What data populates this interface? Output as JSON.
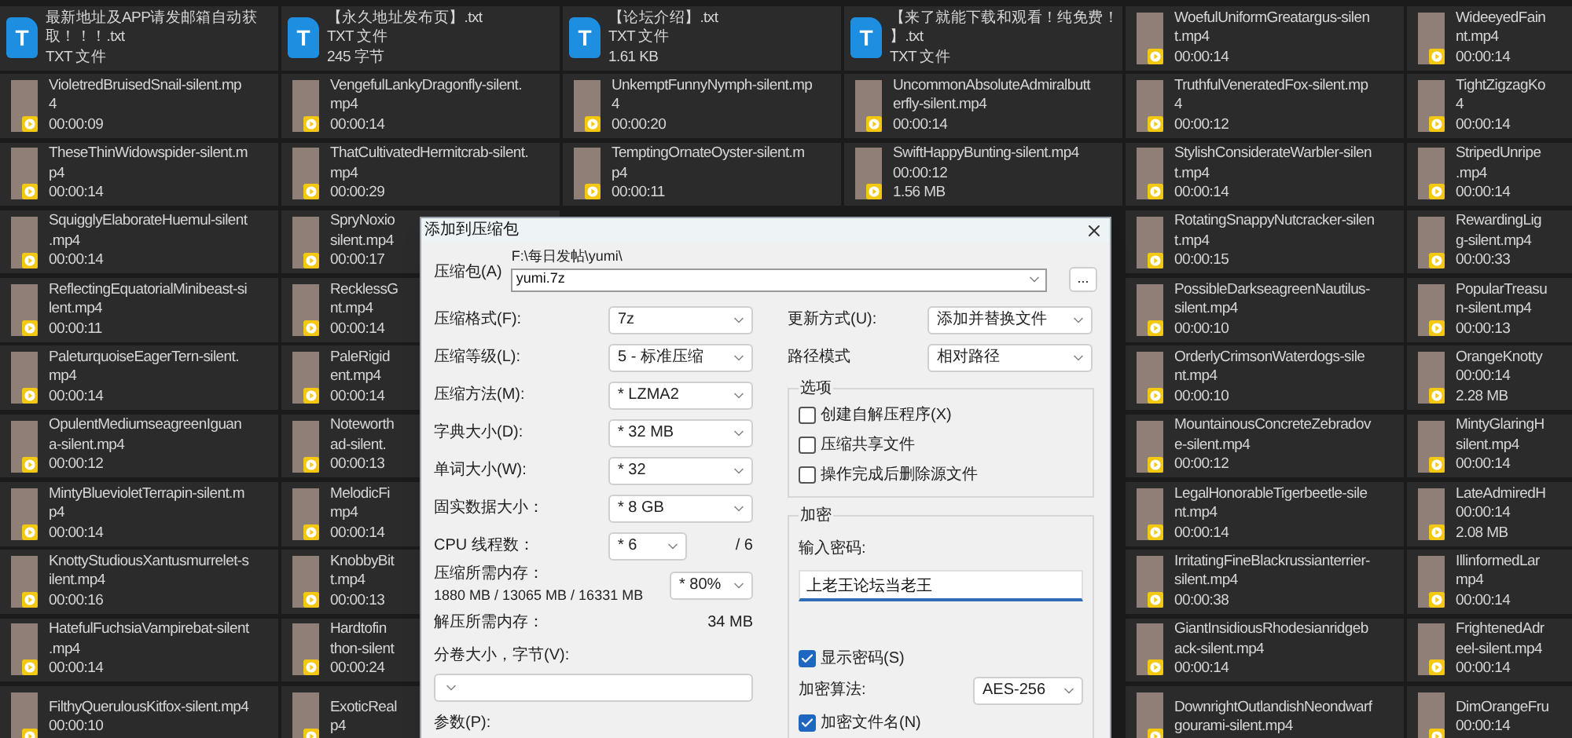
{
  "file_grid": {
    "rows": [
      {
        "tiles": [
          {
            "kind": "txt",
            "icon_letter": "T",
            "lines": [
              "最新地址及APP请发邮箱自动获",
              "取！！！.txt",
              "TXT 文件"
            ]
          },
          {
            "kind": "txt",
            "icon_letter": "T",
            "lines": [
              "【永久地址发布页】.txt",
              "TXT 文件",
              "245 字节"
            ]
          },
          {
            "kind": "txt",
            "icon_letter": "T",
            "lines": [
              "【论坛介绍】.txt",
              "TXT 文件",
              "1.61 KB"
            ]
          },
          {
            "kind": "txt",
            "icon_letter": "T",
            "lines": [
              "【来了就能下载和观看！纯免费！",
              "】.txt",
              "TXT 文件"
            ]
          },
          {
            "kind": "video",
            "lines": [
              "WoefulUniformGreatargus-silen",
              "t.mp4",
              "00:00:14"
            ]
          },
          {
            "kind": "video",
            "lines": [
              "WideeyedFain",
              "nt.mp4",
              "00:00:14"
            ]
          }
        ]
      },
      {
        "tiles": [
          {
            "kind": "video",
            "lines": [
              "VioletredBruisedSnail-silent.mp",
              "4",
              "00:00:09"
            ]
          },
          {
            "kind": "video",
            "lines": [
              "VengefulLankyDragonfly-silent.",
              "mp4",
              "00:00:14"
            ]
          },
          {
            "kind": "video",
            "lines": [
              "UnkemptFunnyNymph-silent.mp",
              "4",
              "00:00:20"
            ]
          },
          {
            "kind": "video",
            "lines": [
              "UncommonAbsoluteAdmiralbutt",
              "erfly-silent.mp4",
              "00:00:14"
            ]
          },
          {
            "kind": "video",
            "lines": [
              "TruthfulVeneratedFox-silent.mp",
              "4",
              "00:00:12"
            ]
          },
          {
            "kind": "video",
            "lines": [
              "TightZigzagKo",
              "4",
              "00:00:14"
            ]
          }
        ]
      },
      {
        "tiles": [
          {
            "kind": "video",
            "lines": [
              "TheseThinWidowspider-silent.m",
              "p4",
              "00:00:14"
            ]
          },
          {
            "kind": "video",
            "lines": [
              "ThatCultivatedHermitcrab-silent.",
              "mp4",
              "00:00:29"
            ]
          },
          {
            "kind": "video",
            "lines": [
              "TemptingOrnateOyster-silent.m",
              "p4",
              "00:00:11"
            ]
          },
          {
            "kind": "video",
            "lines": [
              "SwiftHappyBunting-silent.mp4",
              "00:00:12",
              "1.56 MB"
            ]
          },
          {
            "kind": "video",
            "lines": [
              "StylishConsiderateWarbler-silen",
              "t.mp4",
              "00:00:14"
            ]
          },
          {
            "kind": "video",
            "lines": [
              "StripedUnripe",
              ".mp4",
              "00:00:14"
            ]
          }
        ]
      },
      {
        "tiles": [
          {
            "kind": "video",
            "lines": [
              "SquigglyElaborateHuemul-silent",
              ".mp4",
              "00:00:14"
            ]
          },
          {
            "kind": "video",
            "lines": [
              "SpryNoxio",
              "silent.mp4",
              "00:00:17"
            ]
          },
          {
            "kind": "video",
            "lines": [
              "RotatingSnappyNutcracker-silen",
              "t.mp4",
              "00:00:15"
            ]
          },
          {
            "kind": "video",
            "lines": [
              "RewardingLig",
              "g-silent.mp4",
              "00:00:33"
            ]
          }
        ]
      },
      {
        "tiles": [
          {
            "kind": "video",
            "lines": [
              "ReflectingEquatorialMinibeast-si",
              "lent.mp4",
              "00:00:11"
            ]
          },
          {
            "kind": "video",
            "lines": [
              "RecklessG",
              "nt.mp4",
              "00:00:14"
            ]
          },
          {
            "kind": "video",
            "lines": [
              "PossibleDarkseagreenNautilus-",
              "silent.mp4",
              "00:00:10"
            ]
          },
          {
            "kind": "video",
            "lines": [
              "PopularTreasu",
              "n-silent.mp4",
              "00:00:13"
            ]
          }
        ]
      },
      {
        "tiles": [
          {
            "kind": "video",
            "lines": [
              "PaleturquoiseEagerTern-silent.",
              "mp4",
              "00:00:14"
            ]
          },
          {
            "kind": "video",
            "lines": [
              "PaleRigid",
              "ent.mp4",
              "00:00:14"
            ]
          },
          {
            "kind": "video",
            "lines": [
              "OrderlyCrimsonWaterdogs-sile",
              "nt.mp4",
              "00:00:10"
            ]
          },
          {
            "kind": "video",
            "lines": [
              "OrangeKnotty",
              "00:00:14",
              "2.28 MB"
            ]
          }
        ]
      },
      {
        "tiles": [
          {
            "kind": "video",
            "lines": [
              "OpulentMediumseagreenIguan",
              "a-silent.mp4",
              "00:00:12"
            ]
          },
          {
            "kind": "video",
            "lines": [
              "Noteworth",
              "ad-silent.",
              "00:00:13"
            ]
          },
          {
            "kind": "video",
            "lines": [
              "MountainousConcreteZebradov",
              "e-silent.mp4",
              "00:00:12"
            ]
          },
          {
            "kind": "video",
            "lines": [
              "MintyGlaringH",
              "silent.mp4",
              "00:00:14"
            ]
          }
        ]
      },
      {
        "tiles": [
          {
            "kind": "video",
            "lines": [
              "MintyBluevioletTerrapin-silent.m",
              "p4",
              "00:00:14"
            ]
          },
          {
            "kind": "video",
            "lines": [
              "MelodicFi",
              "mp4",
              "00:00:14"
            ]
          },
          {
            "kind": "video",
            "lines": [
              "LegalHonorableTigerbeetle-sile",
              "nt.mp4",
              "00:00:14"
            ]
          },
          {
            "kind": "video",
            "lines": [
              "LateAdmiredH",
              "00:00:14",
              "2.08 MB"
            ]
          }
        ]
      },
      {
        "tiles": [
          {
            "kind": "video",
            "lines": [
              "KnottyStudiousXantusmurrelet-s",
              "ilent.mp4",
              "00:00:16"
            ]
          },
          {
            "kind": "video",
            "lines": [
              "KnobbyBit",
              "t.mp4",
              "00:00:13"
            ]
          },
          {
            "kind": "video",
            "lines": [
              "IrritatingFineBlackrussianterrier-",
              "silent.mp4",
              "00:00:38"
            ]
          },
          {
            "kind": "video",
            "lines": [
              "IllinformedLar",
              "mp4",
              "00:00:14"
            ]
          }
        ]
      },
      {
        "tiles": [
          {
            "kind": "video",
            "lines": [
              "HatefulFuchsiaVampirebat-silent",
              ".mp4",
              "00:00:14"
            ]
          },
          {
            "kind": "video",
            "lines": [
              "Hardtofin",
              "thon-silent",
              "00:00:24"
            ]
          },
          {
            "kind": "video",
            "lines": [
              "GiantInsidiousRhodesianridgeb",
              "ack-silent.mp4",
              "00:00:14"
            ]
          },
          {
            "kind": "video",
            "lines": [
              "FrightenedAdr",
              "eel-silent.mp4",
              "00:00:14"
            ]
          }
        ]
      },
      {
        "tiles": [
          {
            "kind": "video",
            "lines": [
              "FilthyQuerulousKitfox-silent.mp4",
              "00:00:10"
            ]
          },
          {
            "kind": "video",
            "lines": [
              "ExoticReal",
              "p4"
            ]
          },
          {
            "kind": "video",
            "lines": [
              "DownrightOutlandishNeondwarf",
              "gourami-silent.mp4"
            ]
          },
          {
            "kind": "video",
            "lines": [
              "DimOrangeFru",
              "00:00:14"
            ]
          }
        ]
      }
    ]
  },
  "dialog": {
    "title": "添加到压缩包",
    "archive": {
      "label": "压缩包(A)",
      "path": "F:\\每日发帖\\yumi\\",
      "value": "yumi.7z",
      "browse": "..."
    },
    "left_rows": [
      {
        "kind": "select",
        "label": "压缩格式(F):",
        "value": "7z"
      },
      {
        "kind": "select",
        "label": "压缩等级(L):",
        "value": "5 - 标准压缩"
      },
      {
        "kind": "select",
        "label": "压缩方法(M):",
        "value": "* LZMA2"
      },
      {
        "kind": "select",
        "label": "字典大小(D):",
        "value": "* 32 MB"
      },
      {
        "kind": "select",
        "label": "单词大小(W):",
        "value": "* 32"
      },
      {
        "kind": "select",
        "label": "固实数据大小：",
        "value": "* 8 GB"
      },
      {
        "kind": "threads",
        "label": "CPU 线程数：",
        "value": "* 6",
        "total": "/ 6"
      },
      {
        "kind": "memory",
        "label": "压缩所需内存：",
        "detail": "1880 MB / 13065 MB / 16331 MB",
        "value": "* 80%"
      },
      {
        "kind": "reading",
        "label": "解压所需内存：",
        "reading": "34 MB"
      },
      {
        "kind": "wide_select",
        "label": "分卷大小，字节(V):"
      },
      {
        "kind": "field",
        "label": "参数(P):"
      }
    ],
    "right_rows": [
      {
        "label": "更新方式(U):",
        "value": "添加并替换文件"
      },
      {
        "label": "路径模式",
        "value": "相对路径"
      }
    ],
    "options": {
      "title": "选项",
      "items": [
        {
          "label": "创建自解压程序(X)",
          "checked": false
        },
        {
          "label": "压缩共享文件",
          "checked": false
        },
        {
          "label": "操作完成后删除源文件",
          "checked": false
        }
      ]
    },
    "encryption": {
      "title": "加密",
      "password_label": "输入密码:",
      "password": "上老王论坛当老王",
      "show_password": {
        "label": "显示密码(S)",
        "checked": true
      },
      "method_label": "加密算法:",
      "method": "AES-256",
      "encrypt_names": {
        "label": "加密文件名(N)",
        "checked": true
      }
    }
  }
}
